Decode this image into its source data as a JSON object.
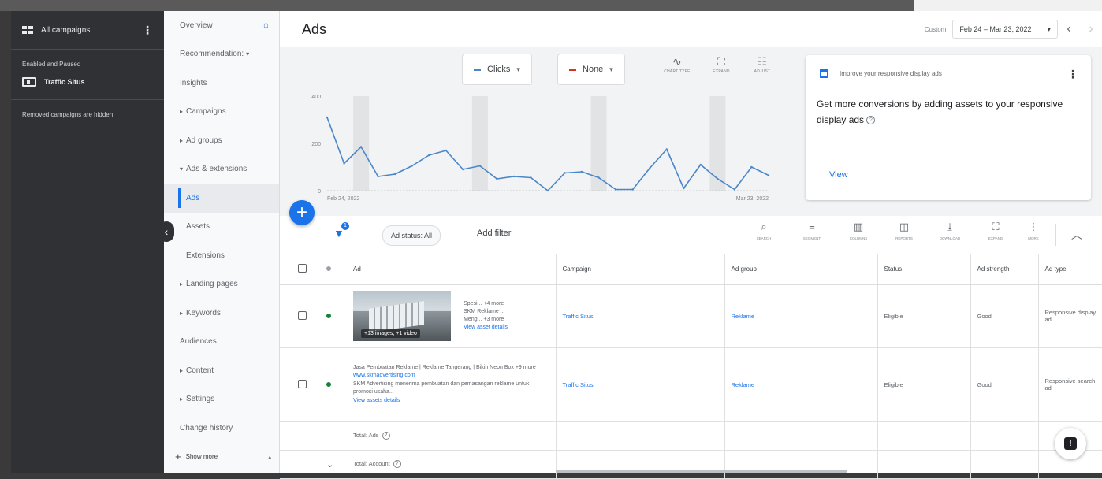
{
  "campaign_panel": {
    "title": "All campaigns",
    "section_label": "Enabled and Paused",
    "campaigns": [
      "Traffic Situs"
    ],
    "hidden_note": "Removed campaigns are hidden"
  },
  "nav": {
    "items": [
      {
        "label": "Overview",
        "type": "plain"
      },
      {
        "label": "Recommendation:",
        "type": "dropdown"
      },
      {
        "label": "Insights",
        "type": "plain"
      },
      {
        "label": "Campaigns",
        "type": "group"
      },
      {
        "label": "Ad groups",
        "type": "group"
      },
      {
        "label": "Ads & extensions",
        "type": "group-open"
      },
      {
        "label": "Ads",
        "type": "child-active"
      },
      {
        "label": "Assets",
        "type": "child"
      },
      {
        "label": "Extensions",
        "type": "child"
      },
      {
        "label": "Landing pages",
        "type": "group"
      },
      {
        "label": "Keywords",
        "type": "group"
      },
      {
        "label": "Audiences",
        "type": "plain"
      },
      {
        "label": "Content",
        "type": "group"
      },
      {
        "label": "Settings",
        "type": "group"
      },
      {
        "label": "Change history",
        "type": "plain"
      }
    ],
    "show_more": "Show more"
  },
  "topbar": {
    "title": "Ads",
    "custom_label": "Custom",
    "date_range": "Feb 24 – Mar 23, 2022"
  },
  "chart_controls": {
    "metric1": "Clicks",
    "metric2": "None",
    "tools": [
      "CHART TYPE",
      "EXPAND",
      "ADJUST"
    ]
  },
  "chart_data": {
    "type": "line",
    "title": "",
    "xlabel": "",
    "ylabel": "",
    "ylim": [
      0,
      400
    ],
    "yticks": [
      0,
      200,
      400
    ],
    "x_start_label": "Feb 24, 2022",
    "x_end_label": "Mar 23, 2022",
    "series": [
      {
        "color": "#4a86c8",
        "values": [
          310,
          115,
          185,
          60,
          70,
          105,
          150,
          170,
          90,
          105,
          50,
          60,
          55,
          0,
          75,
          80,
          55,
          5,
          5,
          95,
          175,
          10,
          110,
          50,
          5,
          100,
          65
        ]
      }
    ],
    "shaded_bands": true,
    "grid": false
  },
  "promo_card": {
    "heading": "Improve your responsive display ads",
    "body": "Get more conversions by adding assets to your responsive display ads",
    "action": "View"
  },
  "filterbar": {
    "badge": "1",
    "chip": "Ad status: All",
    "add_filter": "Add filter",
    "tools": [
      "SEARCH",
      "SEGMENT",
      "COLUMNS",
      "REPORTS",
      "DOWNLOAD",
      "EXPAND",
      "MORE"
    ]
  },
  "table": {
    "headers": [
      "Ad",
      "Campaign",
      "Ad group",
      "Status",
      "Ad strength",
      "Ad type"
    ],
    "rows": [
      {
        "thumb_overlay": "+13 images, +1 video",
        "meta_lines": [
          "Spesi... +4 more",
          "SKM Reklame ...",
          "Meng... +3 more"
        ],
        "meta_link": "View asset details",
        "campaign": "Traffic Situs",
        "ad_group": "Reklame",
        "status": "Eligible",
        "strength": "Good",
        "ad_type": "Responsive display ad"
      },
      {
        "headline": "Jasa Pembuatan Reklame | Reklame Tangerang | Bikin Neon Box +9 more",
        "url": "www.skmadvertising.com",
        "desc": "SKM Advertising menerima pembuatan dan pemasangan reklame untuk promosi usaha...",
        "meta_link": "View assets details",
        "campaign": "Traffic Situs",
        "ad_group": "Reklame",
        "status": "Eligible",
        "strength": "Good",
        "ad_type": "Responsive search ad"
      }
    ],
    "total_ads": "Total: Ads",
    "total_account": "Total: Account"
  }
}
